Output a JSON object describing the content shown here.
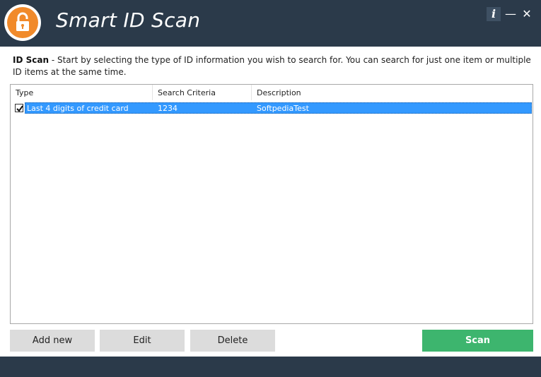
{
  "window": {
    "title": "Smart ID Scan",
    "info_label": "i",
    "minimize_label": "—",
    "close_label": "✕"
  },
  "intro": {
    "heading": "ID Scan",
    "text": " - Start by selecting the type of ID information you wish to search for.  You can search for just one item or multiple ID items at the same time."
  },
  "table": {
    "columns": [
      "Type",
      "Search Criteria",
      "Description"
    ],
    "rows": [
      {
        "checked": true,
        "type": "Last 4 digits of credit card",
        "criteria": "1234",
        "description": "SoftpediaTest"
      }
    ]
  },
  "buttons": {
    "add_new": "Add new",
    "edit": "Edit",
    "delete": "Delete",
    "scan": "Scan"
  },
  "colors": {
    "titlebar": "#2b3a4a",
    "accent_orange": "#f18a2a",
    "selection": "#3399ff",
    "scan_green": "#3db56e"
  },
  "icons": {
    "logo": "padlock-icon",
    "checkbox": "checkmark-icon"
  }
}
